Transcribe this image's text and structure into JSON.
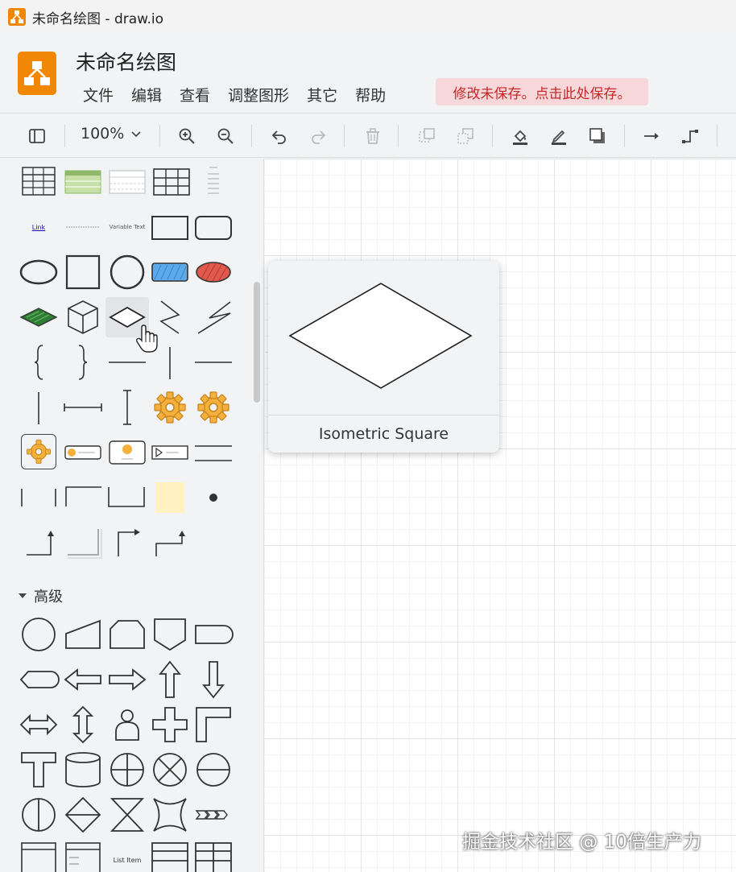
{
  "window": {
    "title": "未命名绘图 - draw.io"
  },
  "header": {
    "doc_title": "未命名绘图",
    "menu": [
      "文件",
      "编辑",
      "查看",
      "调整图形",
      "其它",
      "帮助"
    ],
    "save_notice": "修改未保存。点击此处保存。"
  },
  "toolbar": {
    "zoom": "100%"
  },
  "sidebar": {
    "sections": [
      {
        "title": "高级",
        "expanded": true
      }
    ],
    "shape_texts": {
      "link": "Link",
      "variable_text": "Variable Text",
      "list_item": "List Item"
    }
  },
  "tooltip": {
    "title": "Isometric Square"
  },
  "watermark": "掘金技术社区 @ 10倍生产力",
  "colors": {
    "accent_orange": "#f08705",
    "save_notice_bg": "#f8d7da",
    "save_notice_text": "#c62828",
    "shape_blue": "#5da9e9",
    "shape_red": "#e05a4f",
    "shape_green": "#2e7d32",
    "note_yellow": "#fff2c0"
  }
}
